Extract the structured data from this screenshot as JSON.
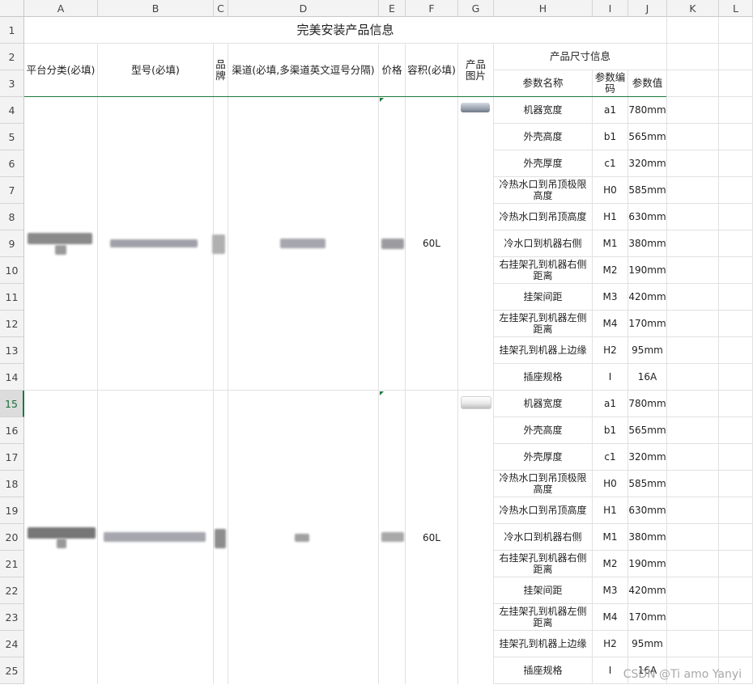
{
  "columns": [
    "A",
    "B",
    "C",
    "D",
    "E",
    "F",
    "G",
    "H",
    "I",
    "J",
    "K",
    "L"
  ],
  "rows": [
    "1",
    "2",
    "3",
    "4",
    "5",
    "6",
    "7",
    "8",
    "9",
    "10",
    "11",
    "12",
    "13",
    "14",
    "15",
    "16",
    "17",
    "18",
    "19",
    "20",
    "21",
    "22",
    "23",
    "24",
    "25"
  ],
  "sheet": {
    "title": "完美安装产品信息",
    "headers": {
      "platform": "平台分类(必填)",
      "model": "型号(必填)",
      "brand": "品牌",
      "channel": "渠道(必填,多渠道英文逗号分隔)",
      "price": "价格",
      "volume": "容积(必填)",
      "image": "产品图片",
      "size_info": "产品尺寸信息",
      "param_name": "参数名称",
      "param_code": "参数编码",
      "param_value": "参数值"
    },
    "products": [
      {
        "volume": "60L",
        "params": [
          {
            "name": "机器宽度",
            "code": "a1",
            "value": "780mm"
          },
          {
            "name": "外壳高度",
            "code": "b1",
            "value": "565mm"
          },
          {
            "name": "外壳厚度",
            "code": "c1",
            "value": "320mm"
          },
          {
            "name": "冷热水口到吊顶极限高度",
            "code": "H0",
            "value": "585mm"
          },
          {
            "name": "冷热水口到吊顶高度",
            "code": "H1",
            "value": "630mm"
          },
          {
            "name": "冷水口到机器右侧",
            "code": "M1",
            "value": "380mm"
          },
          {
            "name": "右挂架孔到机器右侧距离",
            "code": "M2",
            "value": "190mm"
          },
          {
            "name": "挂架间距",
            "code": "M3",
            "value": "420mm"
          },
          {
            "name": "左挂架孔到机器左侧距离",
            "code": "M4",
            "value": "170mm"
          },
          {
            "name": "挂架孔到机器上边缘",
            "code": "H2",
            "value": "95mm"
          },
          {
            "name": "插座规格",
            "code": "I",
            "value": "16A"
          }
        ]
      },
      {
        "volume": "60L",
        "params": [
          {
            "name": "机器宽度",
            "code": "a1",
            "value": "780mm"
          },
          {
            "name": "外壳高度",
            "code": "b1",
            "value": "565mm"
          },
          {
            "name": "外壳厚度",
            "code": "c1",
            "value": "320mm"
          },
          {
            "name": "冷热水口到吊顶极限高度",
            "code": "H0",
            "value": "585mm"
          },
          {
            "name": "冷热水口到吊顶高度",
            "code": "H1",
            "value": "630mm"
          },
          {
            "name": "冷水口到机器右侧",
            "code": "M1",
            "value": "380mm"
          },
          {
            "name": "右挂架孔到机器右侧距离",
            "code": "M2",
            "value": "190mm"
          },
          {
            "name": "挂架间距",
            "code": "M3",
            "value": "420mm"
          },
          {
            "name": "左挂架孔到机器左侧距离",
            "code": "M4",
            "value": "170mm"
          },
          {
            "name": "挂架孔到机器上边缘",
            "code": "H2",
            "value": "95mm"
          },
          {
            "name": "插座规格",
            "code": "I",
            "value": "16A"
          }
        ]
      }
    ]
  },
  "active_row": "15",
  "accent_color": "#1c7a3e",
  "watermark": "CSDN @Ti amo Yanyi"
}
